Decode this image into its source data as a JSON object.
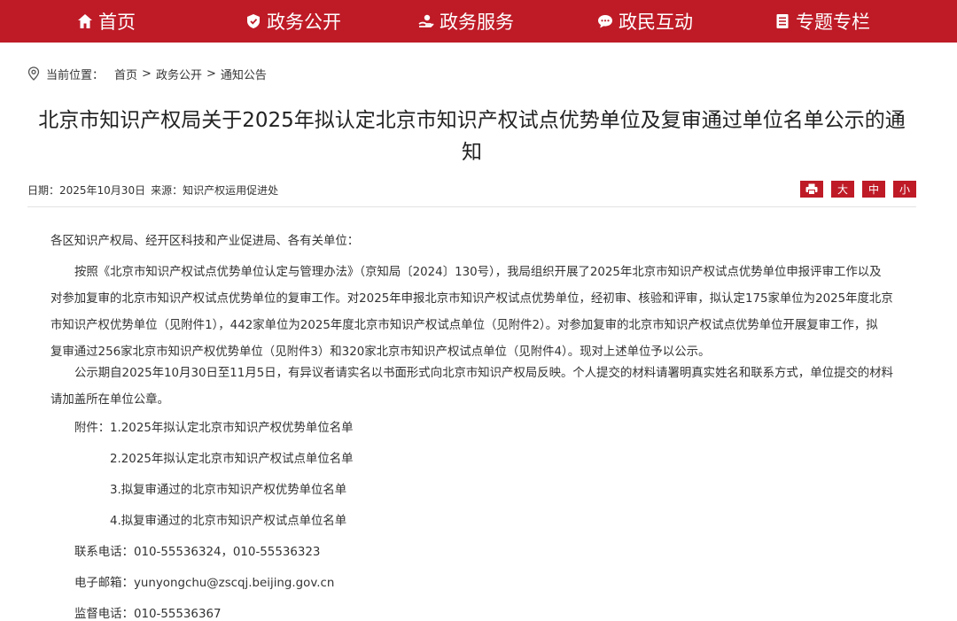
{
  "nav": {
    "items": [
      {
        "label": "首页",
        "icon": "home-icon"
      },
      {
        "label": "政务公开",
        "icon": "govt-open-icon"
      },
      {
        "label": "政务服务",
        "icon": "service-icon"
      },
      {
        "label": "政民互动",
        "icon": "chat-icon"
      },
      {
        "label": "专题专栏",
        "icon": "topic-icon"
      }
    ]
  },
  "breadcrumb": {
    "prefix": "当前位置：",
    "items": [
      "首页",
      "政务公开",
      "通知公告"
    ],
    "separator": ">"
  },
  "article": {
    "title_line1": "北京市知识产权局关于2025年拟认定北京市知识产权试点优势单位及复审通过单位名单公示的通",
    "title_line2": "知",
    "date": "日期：2025年10月30日",
    "source": "来源：知识产权运用促进处",
    "tools": {
      "large": "大",
      "medium": "中",
      "small": "小"
    },
    "salutation": "各区知识产权局、经开区科技和产业促进局、各有关单位：",
    "para1": [
      "按照《北京市知识产权试点优势单位认定与管理办法》（京知局〔2024〕130号），我局组织开展了2025年北京市知识产权试点优势单位申报评审工作以及",
      "对参加复审的北京市知识产权试点优势单位的复审工作。对2025年申报北京市知识产权试点优势单位，经初审、核验和评审，拟认定175家单位为2025年度北京",
      "市知识产权优势单位（见附件1），442家单位为2025年度北京市知识产权试点单位（见附件2）。对参加复审的北京市知识产权试点优势单位开展复审工作，拟",
      "复审通过256家北京市知识产权优势单位（见附件3）和320家北京市知识产权试点单位（见附件4）。现对上述单位予以公示。"
    ],
    "para2": [
      "公示期自2025年10月30日至11月5日，有异议者请实名以书面形式向北京市知识产权局反映。个人提交的材料请署明真实姓名和联系方式，单位提交的材料",
      "请加盖所在单位公章。"
    ],
    "attachments_label": "附件：",
    "attachments": [
      "1.2025年拟认定北京市知识产权优势单位名单",
      "2.2025年拟认定北京市知识产权试点单位名单",
      "3.拟复审通过的北京市知识产权优势单位名单",
      "4.拟复审通过的北京市知识产权试点单位名单"
    ],
    "contact_phone": "联系电话：010-55536324，010-55536323",
    "email": "电子邮箱：yunyongchu@zscqj.beijing.gov.cn",
    "supervise_phone": "监督电话：010-55536367"
  },
  "colors": {
    "brand": "#be1b27",
    "text": "#333333"
  }
}
